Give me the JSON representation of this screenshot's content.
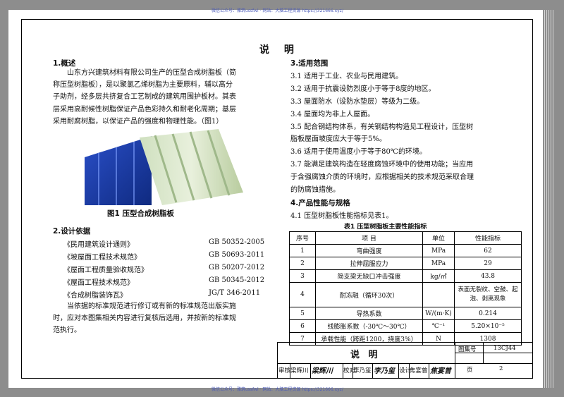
{
  "watermark": "微信公众号：雅筑ussfwl · 网站：大脑工程资源 https://321666.xyz/",
  "page_title": "说 明",
  "section1": {
    "heading": "1.概述",
    "lines": [
      "山东方兴建筑材料有限公司生产的压型合成树脂板（简",
      "称压型树脂板），是以聚氯乙烯树脂为主要原料，辅以高分",
      "子助剂，经多层共挤复合工艺制成的建筑用围护板材。其表",
      "层采用高耐候性树脂保证产品色彩持久和耐老化周期；基层",
      "采用耐腐树脂，以保证产品的强度和物理性能。（图1）"
    ],
    "figure_caption": "图1  压型合成树脂板"
  },
  "section2": {
    "heading": "2.设计依据",
    "standards": [
      {
        "name": "《民用建筑设计通则》",
        "code": "GB 50352-2005"
      },
      {
        "name": "《坡屋面工程技术规范》",
        "code": "GB 50693-2011"
      },
      {
        "name": "《屋面工程质量验收规范》",
        "code": "GB 50207-2012"
      },
      {
        "name": "《屋面工程技术规范》",
        "code": "GB 50345-2012"
      },
      {
        "name": "《合成树脂装饰瓦》",
        "code": "JG/T 346-2011"
      }
    ],
    "note_lines": [
      "当依据的标准规范进行修订或有新的标准规范出版实施",
      "时，应对本图集相关内容进行复核后选用，并按新的标准规",
      "范执行。"
    ]
  },
  "section3": {
    "heading": "3.适用范围",
    "lines": [
      "3.1 适用于工业、农业与民用建筑。",
      "3.2 适用于抗震设防烈度小于等于8度的地区。",
      "3.3 屋面防水（设防水垫层）等级为二级。",
      "3.4 屋面均为非上人屋面。",
      "3.5 配合钢结构体系，有关钢结构构造见工程设计，压型树",
      "脂板屋面坡度应大于等于5%。",
      "3.6 适用于使用温度小于等于80℃的环境。",
      "3.7 能满足建筑构造在轻度腐蚀环境中的使用功能；当应用",
      "于含强腐蚀介质的环境时，应根据相关的技术规范采取合理",
      "的防腐蚀措施。"
    ]
  },
  "section4": {
    "heading": "4.产品性能与规格",
    "intro": "4.1 压型树脂板性能指标见表1。",
    "table_caption": "表1   压型树脂板主要性能指标",
    "headers": [
      "序号",
      "项     目",
      "单位",
      "性能指标"
    ],
    "rows": [
      [
        "1",
        "弯曲强度",
        "MPa",
        "62"
      ],
      [
        "2",
        "拉伸屈服应力",
        "MPa",
        "29"
      ],
      [
        "3",
        "简支梁无缺口冲击强度",
        "kg/㎡",
        "43.8"
      ],
      [
        "4",
        "耐冻融（循环30次）",
        "",
        "表面无裂纹、空鼓、起泡、剥离现象"
      ],
      [
        "5",
        "导热系数",
        "W/(m·K)",
        "0.214"
      ],
      [
        "6",
        "线膨胀系数（-30℃～30℃）",
        "℃⁻¹",
        "5.20×10⁻⁵"
      ],
      [
        "7",
        "承载性能（跨距1200，挠度3%）",
        "N",
        "1308"
      ]
    ]
  },
  "title_block": {
    "name": "说  明",
    "atlas_label": "图集号",
    "atlas_no": "13CJ44",
    "page_label": "页",
    "page_no": "2",
    "review_label": "审核",
    "review_name": "梁辉川",
    "review_sig": "梁辉川",
    "check_label": "校对",
    "check_name": "李乃玺",
    "check_sig": "李乃玺",
    "design_label": "设计",
    "design_name": "焦宴曾",
    "design_sig": "焦宴曾"
  }
}
